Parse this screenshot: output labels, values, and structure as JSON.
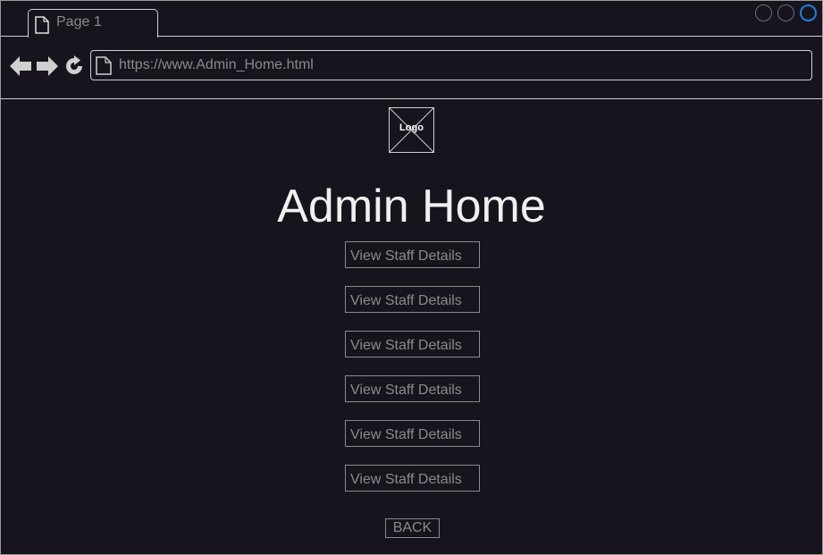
{
  "browser": {
    "tab": {
      "label": "Page 1",
      "icon": "document-icon"
    },
    "window_controls": [
      "circle-button",
      "circle-button",
      "circle-button"
    ],
    "nav": {
      "back_icon": "arrow-left-icon",
      "forward_icon": "arrow-right-icon",
      "reload_icon": "reload-icon"
    },
    "url": {
      "icon": "document-icon",
      "value": "https://www.Admin_Home.html"
    }
  },
  "page": {
    "logo_label": "Logo",
    "title": "Admin Home",
    "staff_buttons": [
      "View Staff Details",
      "View Staff Details",
      "View Staff Details",
      "View Staff Details",
      "View Staff Details",
      "View Staff Details"
    ],
    "back_label": "BACK"
  },
  "colors": {
    "background": "#18141d",
    "text": "#f0f0f0",
    "muted": "#8a8a8a",
    "accent": "#1f7de0"
  }
}
